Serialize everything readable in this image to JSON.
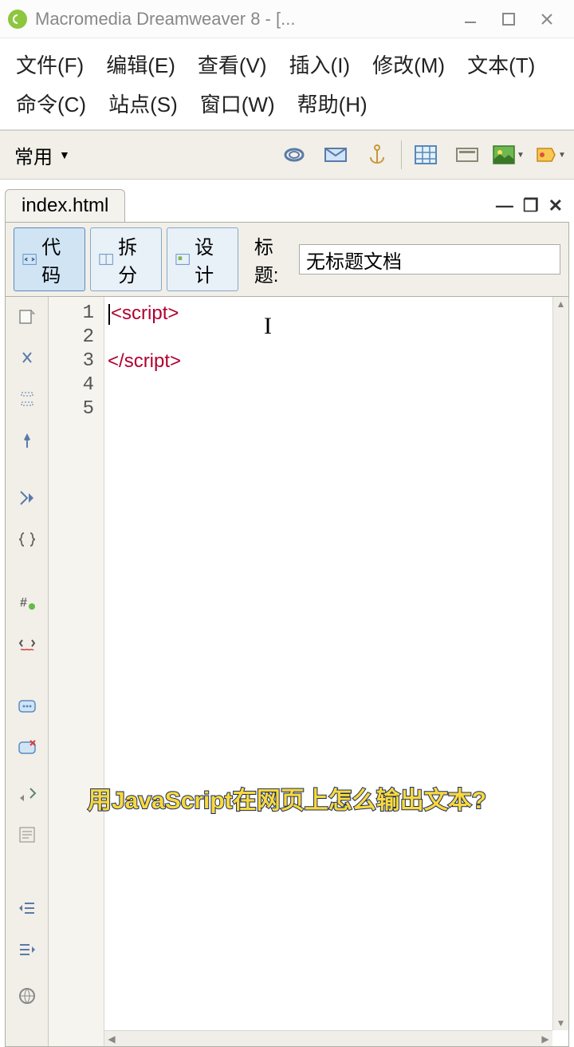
{
  "window": {
    "title": "Macromedia Dreamweaver 8 - [..."
  },
  "menu": {
    "file": "文件(F)",
    "edit": "编辑(E)",
    "view": "查看(V)",
    "insert": "插入(I)",
    "modify": "修改(M)",
    "text": "文本(T)",
    "commands": "命令(C)",
    "site": "站点(S)",
    "window_": "窗口(W)",
    "help": "帮助(H)"
  },
  "toolbar": {
    "category": "常用"
  },
  "document": {
    "tab": "index.html",
    "views": {
      "code": "代码",
      "split": "拆分",
      "design": "设计"
    },
    "title_label": "标题:",
    "title_value": "无标题文档"
  },
  "lines": {
    "l1": "1",
    "l2": "2",
    "l3": "3",
    "l4": "4",
    "l5": "5"
  },
  "code": {
    "line1_open": "<",
    "line1_tag": "script",
    "line1_close": ">",
    "line3_open": "</",
    "line3_tag": "script",
    "line3_close": ">"
  },
  "caption": "用JavaScript在网页上怎么输出文本?"
}
